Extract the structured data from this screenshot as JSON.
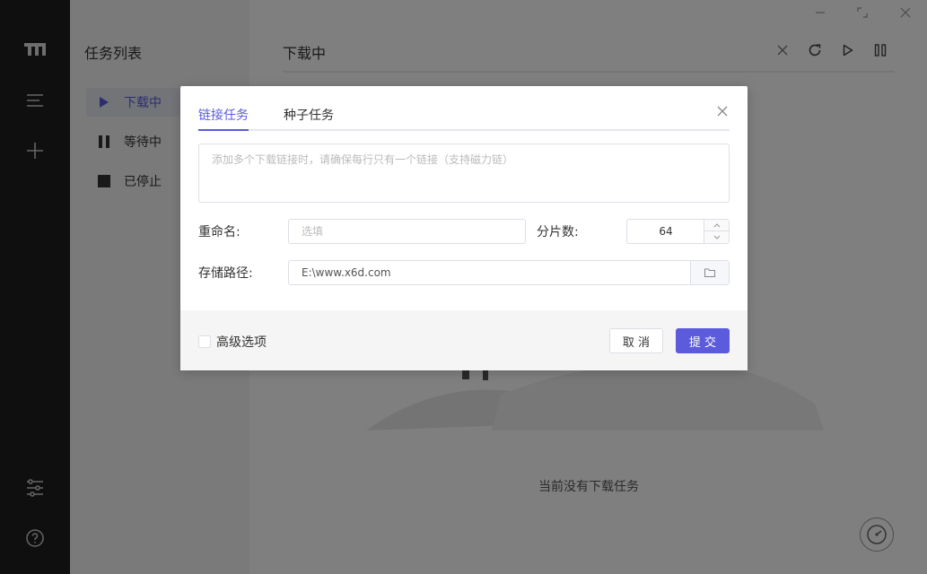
{
  "sidebar": {
    "tasklist_title": "任务列表",
    "items": [
      {
        "label": "下载中",
        "icon": "play-icon"
      },
      {
        "label": "等待中",
        "icon": "pause-icon"
      },
      {
        "label": "已停止",
        "icon": "stop-icon"
      }
    ],
    "rail_icons": [
      "logo-icon",
      "menu-icon",
      "add-icon",
      "settings-sliders-icon",
      "help-icon"
    ]
  },
  "window_controls": [
    "minimize-icon",
    "maximize-icon",
    "close-icon"
  ],
  "main": {
    "title": "下载中",
    "toolbar_icons": [
      "clear-icon",
      "refresh-icon",
      "resume-all-icon",
      "pause-all-icon"
    ],
    "empty_text": "当前没有下载任务"
  },
  "dialog": {
    "tabs": [
      {
        "label": "链接任务",
        "active": true
      },
      {
        "label": "种子任务",
        "active": false
      }
    ],
    "url_placeholder": "添加多个下载链接时，请确保每行只有一个链接（支持磁力链）",
    "rename_label": "重命名:",
    "rename_placeholder": "选填",
    "split_label": "分片数:",
    "split_value": "64",
    "path_label": "存储路径:",
    "path_value": "E:\\www.x6d.com",
    "advanced_label": "高级选项",
    "cancel_label": "取 消",
    "submit_label": "提 交"
  },
  "colors": {
    "accent": "#5b5bdc",
    "rail_bg": "#1f1f1f",
    "overlay": "rgba(0,0,0,0.5)"
  }
}
